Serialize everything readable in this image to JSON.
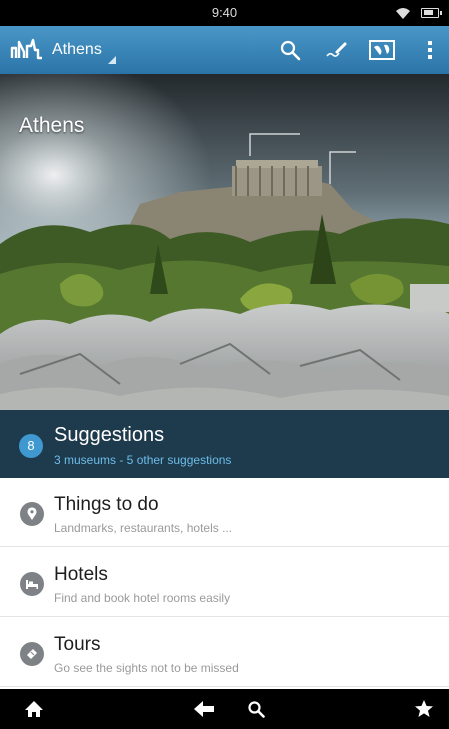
{
  "status_bar": {
    "time": "9:40"
  },
  "action_bar": {
    "title": "Athens",
    "icons": [
      "app-logo-icon",
      "search-icon",
      "edit-icon",
      "map-icon",
      "overflow-menu-icon"
    ]
  },
  "hero": {
    "title": "Athens",
    "image": "acropolis-photo"
  },
  "suggestions": {
    "count": "8",
    "title": "Suggestions",
    "subtitle": "3 museums - 5 other suggestions"
  },
  "list": {
    "items": [
      {
        "icon": "map-pin-icon",
        "title": "Things to do",
        "subtitle": "Landmarks, restaurants, hotels ..."
      },
      {
        "icon": "bed-icon",
        "title": "Hotels",
        "subtitle": "Find and book hotel rooms easily"
      },
      {
        "icon": "ticket-icon",
        "title": "Tours",
        "subtitle": "Go see the sights not to be missed"
      }
    ]
  },
  "bottom_bar": {
    "icons": [
      "home-icon",
      "back-icon",
      "search-icon",
      "star-icon"
    ]
  },
  "colors": {
    "action_bar": "#3a87bb",
    "suggestions_bg": "#1e3a4d",
    "badge": "#3f99d0",
    "subtitle_accent": "#6cbde8"
  }
}
